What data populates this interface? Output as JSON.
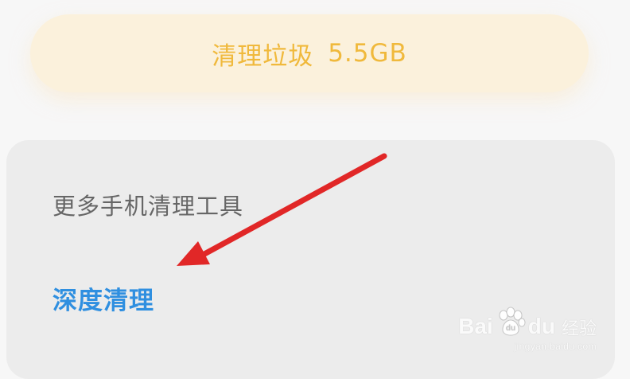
{
  "clean_button": {
    "label": "清理垃圾",
    "size": "5.5GB"
  },
  "tools_card": {
    "title": "更多手机清理工具",
    "deep_clean_label": "深度清理"
  },
  "watermark": {
    "brand_prefix": "Bai",
    "brand_suffix": "du",
    "experience": "经验",
    "url": "jingyan.baidu.com"
  },
  "colors": {
    "clean_text": "#f0b93c",
    "deep_clean_text": "#2f8fe0",
    "arrow": "#e12727"
  },
  "icons": {
    "watermark_logo": "paw-icon",
    "annotation": "arrow-icon"
  }
}
